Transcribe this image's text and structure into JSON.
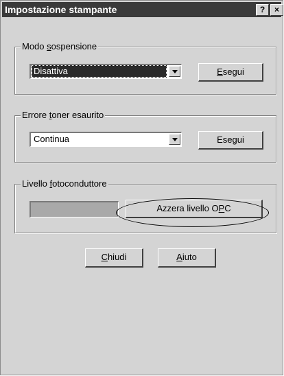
{
  "window": {
    "title": "Impostazione stampante",
    "help_glyph": "?",
    "close_glyph": "×"
  },
  "sleep_mode": {
    "group_label_pre": "Modo ",
    "group_label_u": "s",
    "group_label_post": "ospensione",
    "selected": "Disattiva",
    "exec_pre": "",
    "exec_u": "E",
    "exec_post": "segui"
  },
  "toner_error": {
    "group_label_pre": "Errore ",
    "group_label_u": "t",
    "group_label_post": "oner esaurito",
    "selected": "Continua",
    "exec_pre": "Ese",
    "exec_u": "g",
    "exec_post": "ui"
  },
  "photoconductor": {
    "group_label_pre": "Livello ",
    "group_label_u": "f",
    "group_label_post": "otoconduttore",
    "reset_pre": "Azzera livello O",
    "reset_u": "P",
    "reset_post": "C"
  },
  "footer": {
    "close_u": "C",
    "close_post": "hiudi",
    "help_u": "A",
    "help_post": "iuto"
  }
}
